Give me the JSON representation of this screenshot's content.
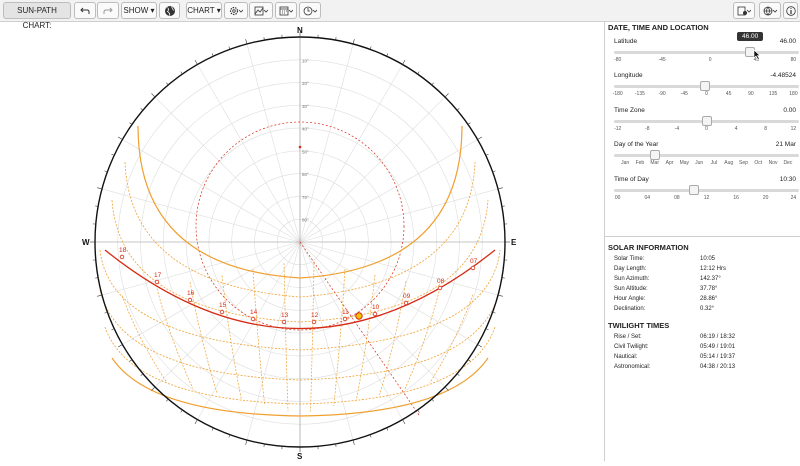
{
  "toolbar": {
    "title": "SUN-PATH CHART:",
    "show_label": "SHOW",
    "chart_label": "CHART"
  },
  "chart": {
    "compass": {
      "n": "N",
      "e": "E",
      "s": "S",
      "w": "W"
    },
    "hour_labels": [
      "18",
      "17",
      "16",
      "15",
      "14",
      "13",
      "12",
      "11",
      "10",
      "09",
      "08",
      "07"
    ],
    "altitude_labels": [
      "10°",
      "20°",
      "30°",
      "40°",
      "50°",
      "60°",
      "70°",
      "80°"
    ],
    "colors": {
      "sun_path": "#d62a14",
      "month_paths": "#f0a030",
      "grid": "#dddddd",
      "outline": "#111111"
    }
  },
  "panel": {
    "section_title": "DATE, TIME AND LOCATION",
    "controls": [
      {
        "label": "Latitude",
        "value": "46.00",
        "ticks": [
          "-80",
          "-45",
          "0",
          "45",
          "80"
        ],
        "fraction": 0.76
      },
      {
        "label": "Longitude",
        "value": "-4.48524",
        "ticks": [
          "-180",
          "-135",
          "-90",
          "-45",
          "0",
          "45",
          "90",
          "135",
          "180"
        ],
        "fraction": 0.49
      },
      {
        "label": "Time Zone",
        "value": "0.00",
        "ticks": [
          "-12",
          "-8",
          "-4",
          "0",
          "4",
          "8",
          "12"
        ],
        "fraction": 0.5
      },
      {
        "label": "Day of the Year",
        "value": "21 Mar",
        "ticks": [
          "Jan",
          "Feb",
          "Mar",
          "Apr",
          "May",
          "Jun",
          "Jul",
          "Aug",
          "Sep",
          "Oct",
          "Nov",
          "Dec"
        ],
        "fraction": 0.22
      },
      {
        "label": "Time of Day",
        "value": "10:30",
        "ticks": [
          "00",
          "04",
          "08",
          "12",
          "16",
          "20",
          "24"
        ],
        "fraction": 0.44
      }
    ],
    "tooltip_value": "46.00",
    "solar_info": {
      "title": "SOLAR INFORMATION",
      "rows": [
        {
          "key": "Solar Time:",
          "value": "10:05"
        },
        {
          "key": "Day Length:",
          "value": "12:12 Hrs"
        },
        {
          "key": "Sun Azimuth:",
          "value": "142.37°"
        },
        {
          "key": "Sun Altitude:",
          "value": "37.78°"
        },
        {
          "key": "Hour Angle:",
          "value": "28.86°"
        },
        {
          "key": "Declination:",
          "value": "0.32°"
        }
      ]
    },
    "twilight": {
      "title": "TWILIGHT TIMES",
      "rows": [
        {
          "key": "Rise / Set:",
          "value": "06:19 / 18:32"
        },
        {
          "key": "Civil Twilight:",
          "value": "05:49 / 19:01"
        },
        {
          "key": "Nautical:",
          "value": "05:14 / 19:37"
        },
        {
          "key": "Astronomical:",
          "value": "04:38 / 20:13"
        }
      ]
    }
  }
}
